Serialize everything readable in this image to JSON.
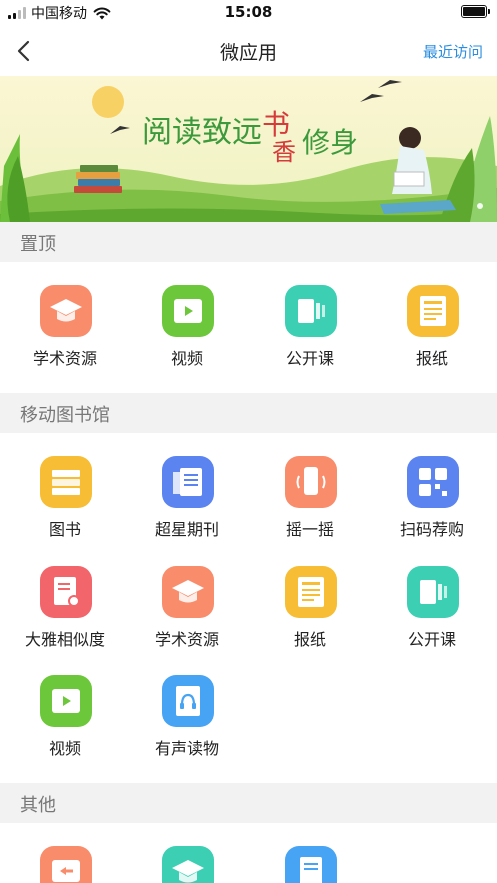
{
  "status_bar": {
    "carrier": "中国移动",
    "time": "15:08"
  },
  "nav": {
    "title": "微应用",
    "recent_link": "最近访问"
  },
  "banner": {
    "title_part1": "阅读致远",
    "title_char1": "书",
    "title_char2": "香",
    "title_part2": "修身"
  },
  "sections": [
    {
      "title": "置顶",
      "items": [
        {
          "label": "学术资源",
          "icon": "graduation-cap-icon",
          "color": "#f98c6a"
        },
        {
          "label": "视频",
          "icon": "video-icon",
          "color": "#6cc83a"
        },
        {
          "label": "公开课",
          "icon": "open-course-icon",
          "color": "#3ccfb4"
        },
        {
          "label": "报纸",
          "icon": "newspaper-icon",
          "color": "#f7bd35"
        }
      ]
    },
    {
      "title": "移动图书馆",
      "items": [
        {
          "label": "图书",
          "icon": "books-icon",
          "color": "#f7bd35"
        },
        {
          "label": "超星期刊",
          "icon": "journal-icon",
          "color": "#5b84f0"
        },
        {
          "label": "摇一摇",
          "icon": "shake-phone-icon",
          "color": "#f98c6a"
        },
        {
          "label": "扫码荐购",
          "icon": "qr-code-icon",
          "color": "#5b84f0"
        },
        {
          "label": "大雅相似度",
          "icon": "document-search-icon",
          "color": "#f2656a"
        },
        {
          "label": "学术资源",
          "icon": "graduation-cap-icon",
          "color": "#f98c6a"
        },
        {
          "label": "报纸",
          "icon": "newspaper-icon",
          "color": "#f7bd35"
        },
        {
          "label": "公开课",
          "icon": "open-course-icon",
          "color": "#3ccfb4"
        },
        {
          "label": "视频",
          "icon": "video-icon",
          "color": "#6cc83a"
        },
        {
          "label": "有声读物",
          "icon": "audiobook-icon",
          "color": "#47a3f3"
        }
      ]
    },
    {
      "title": "其他",
      "items": [
        {
          "label": "",
          "icon": "back-card-icon",
          "color": "#f98c6a"
        },
        {
          "label": "",
          "icon": "graduation-cap-icon",
          "color": "#3ccfb4"
        },
        {
          "label": "",
          "icon": "document-icon",
          "color": "#47a3f3"
        }
      ]
    }
  ]
}
